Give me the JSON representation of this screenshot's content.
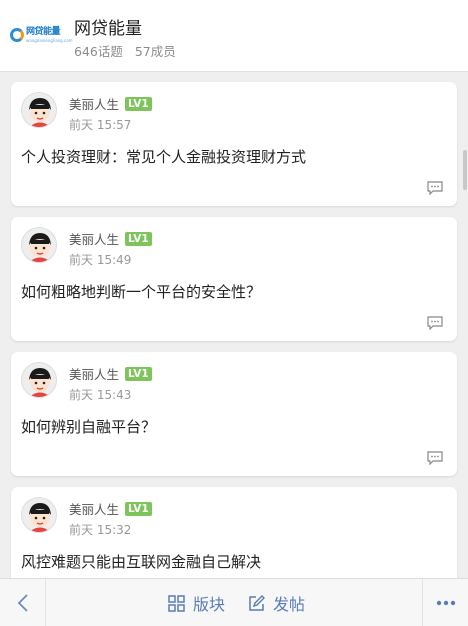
{
  "header": {
    "logo": {
      "text_cn": "网贷能量",
      "text_en": "wangdainengliang.com"
    },
    "title": "网贷能量",
    "topics": "646话题",
    "members": "57成员"
  },
  "posts": [
    {
      "author": "美丽人生",
      "level": "LV1",
      "time": "前天 15:57",
      "title": "个人投资理财：常见个人金融投资理财方式"
    },
    {
      "author": "美丽人生",
      "level": "LV1",
      "time": "前天 15:49",
      "title": "如何粗略地判断一个平台的安全性？"
    },
    {
      "author": "美丽人生",
      "level": "LV1",
      "time": "前天 15:43",
      "title": "如何辨别自融平台？"
    },
    {
      "author": "美丽人生",
      "level": "LV1",
      "time": "前天 15:32",
      "title": "风控难题只能由互联网金融自己解决"
    }
  ],
  "bottom_bar": {
    "board_label": "版块",
    "post_label": "发帖"
  },
  "icons": {
    "back": "chevron-left-icon",
    "board": "grid-icon",
    "post": "edit-icon",
    "more": "more-dots-icon",
    "comment": "comment-icon"
  },
  "colors": {
    "accent": "#5a7db8",
    "level_badge": "#7dc55a",
    "background": "#efefef"
  }
}
